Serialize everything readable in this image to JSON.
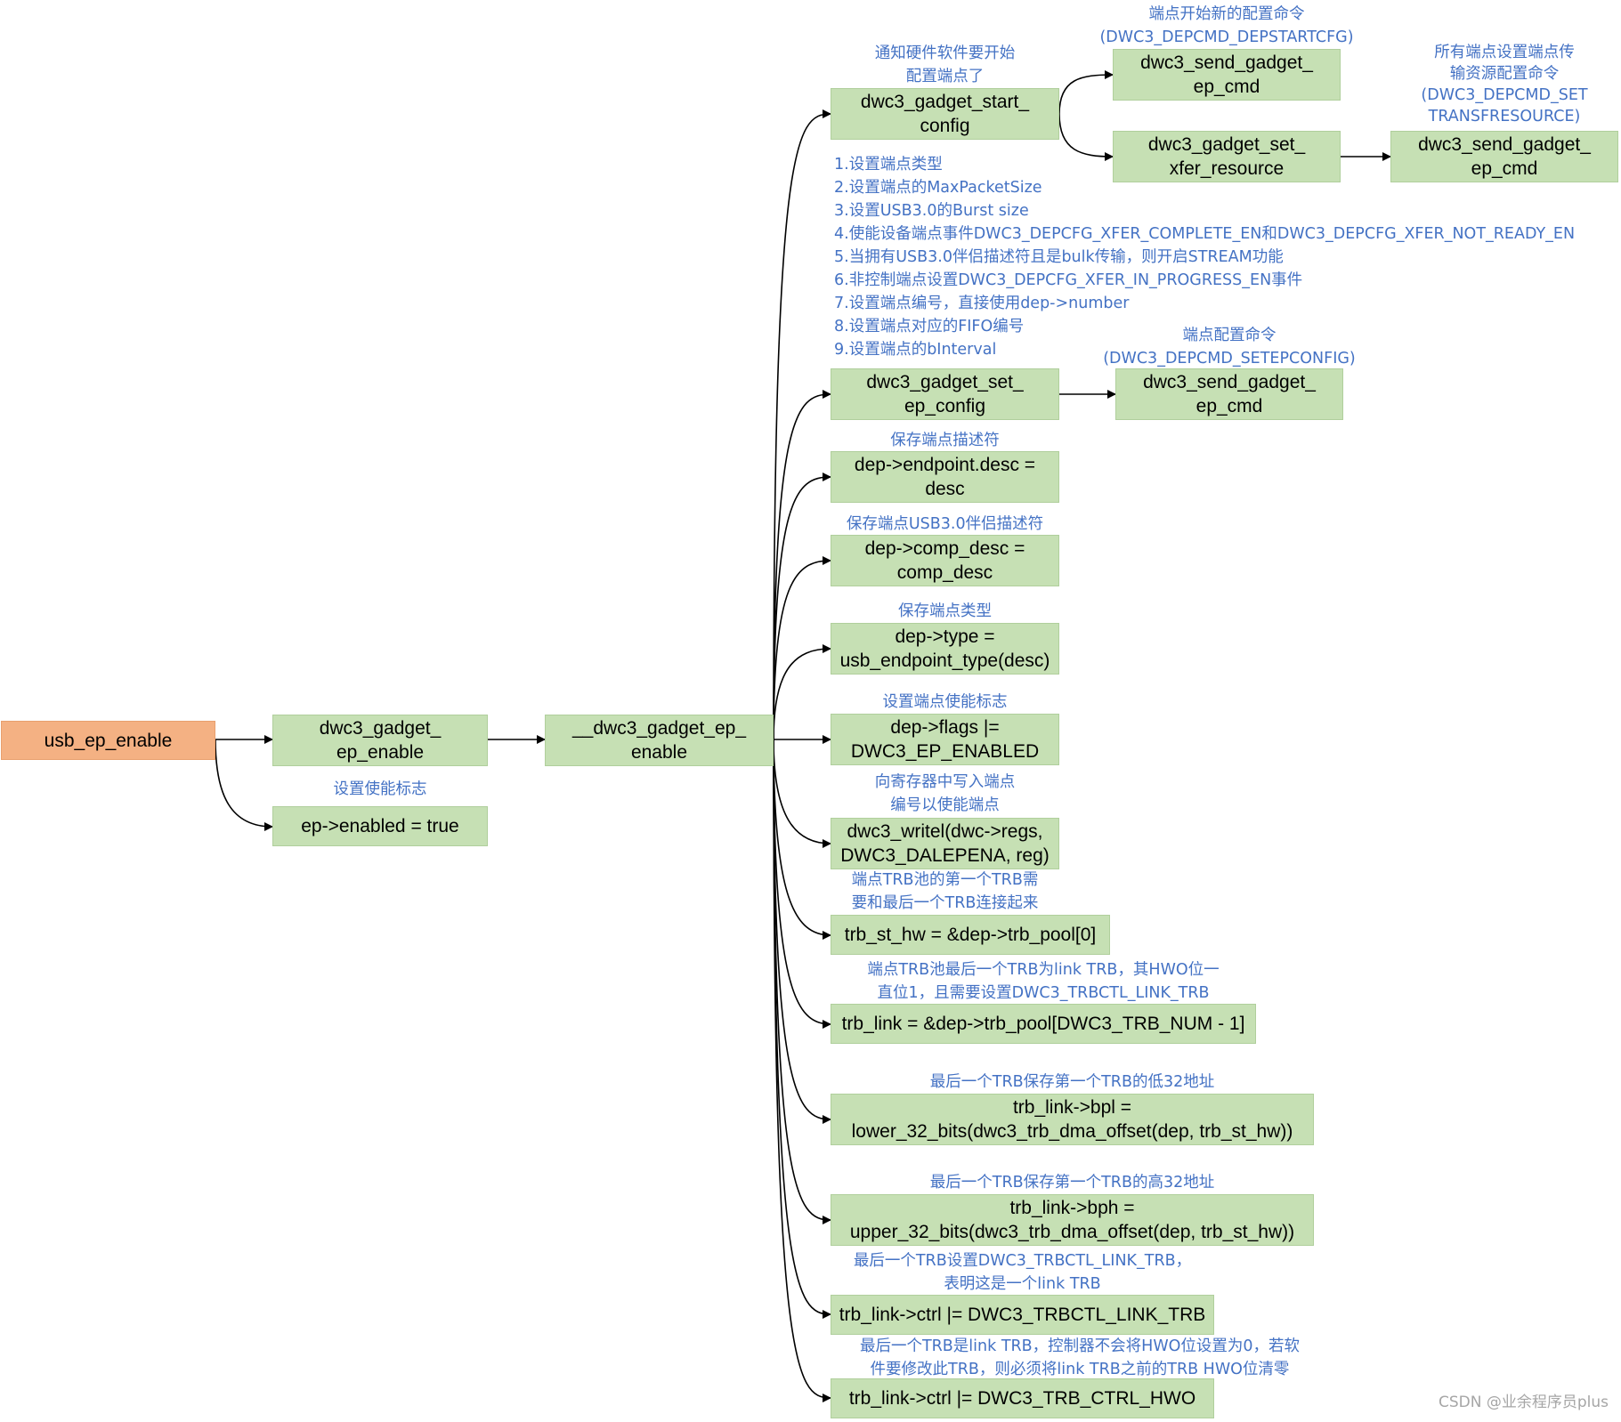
{
  "diagram": {
    "nodes": {
      "usb_ep_enable": "usb_ep_enable",
      "dwc3_gadget_ep_enable": "dwc3_gadget_\nep_enable",
      "ep_enabled_true": "ep->enabled = true",
      "__dwc3_gadget_ep_enable": "__dwc3_gadget_ep_\nenable",
      "dwc3_gadget_start_config": "dwc3_gadget_start_\nconfig",
      "send_cmd_start": "dwc3_send_gadget_\nep_cmd",
      "dwc3_gadget_set_xfer_resource": "dwc3_gadget_set_\nxfer_resource",
      "send_cmd_xfer": "dwc3_send_gadget_\nep_cmd",
      "dwc3_gadget_set_ep_config": "dwc3_gadget_set_\nep_config",
      "send_cmd_config": "dwc3_send_gadget_\nep_cmd",
      "endpoint_desc": "dep->endpoint.desc =\ndesc",
      "comp_desc": "dep->comp_desc =\ncomp_desc",
      "dep_type": "dep->type =\nusb_endpoint_type(desc)",
      "dep_flags": "dep->flags |=\nDWC3_EP_ENABLED",
      "dwc3_writel": "dwc3_writel(dwc->regs,\nDWC3_DALEPENA, reg)",
      "trb_st_hw": "trb_st_hw = &dep->trb_pool[0]",
      "trb_link": "trb_link = &dep->trb_pool[DWC3_TRB_NUM - 1]",
      "trb_link_bpl": "trb_link->bpl =\nlower_32_bits(dwc3_trb_dma_offset(dep, trb_st_hw))",
      "trb_link_bph": "trb_link->bph =\nupper_32_bits(dwc3_trb_dma_offset(dep, trb_st_hw))",
      "trb_link_ctrl_link": "trb_link->ctrl |= DWC3_TRBCTL_LINK_TRB",
      "trb_link_ctrl_hwo": "trb_link->ctrl |= DWC3_TRB_CTRL_HWO"
    },
    "notes": {
      "set_enable_flag": "设置使能标志",
      "notify_hw": "通知硬件软件要开始\n配置端点了",
      "start_cfg_cmd": "端点开始新的配置命令\n(DWC3_DEPCMD_DEPSTARTCFG)",
      "xfer_resource_cmd": "所有端点设置端点传\n输资源配置命令\n(DWC3_DEPCMD_SET\nTRANSFRESOURCE)",
      "ep_config_steps": "1.设置端点类型\n2.设置端点的MaxPacketSize\n3.设置USB3.0的Burst size\n4.使能设备端点事件DWC3_DEPCFG_XFER_COMPLETE_EN和DWC3_DEPCFG_XFER_NOT_READY_EN\n5.当拥有USB3.0伴侣描述符且是bulk传输，则开启STREAM功能\n6.非控制端点设置DWC3_DEPCFG_XFER_IN_PROGRESS_EN事件\n7.设置端点编号，直接使用dep->number\n8.设置端点对应的FIFO编号\n9.设置端点的bInterval",
      "setepconfig_cmd": "端点配置命令\n(DWC3_DEPCMD_SETEPCONFIG)",
      "save_desc": "保存端点描述符",
      "save_comp_desc": "保存端点USB3.0伴侣描述符",
      "save_type": "保存端点类型",
      "set_enable_flag2": "设置端点使能标志",
      "write_reg": "向寄存器中写入端点\n编号以使能端点",
      "trb_first": "端点TRB池的第一个TRB需\n要和最后一个TRB连接起来",
      "trb_last": "端点TRB池最后一个TRB为link TRB，其HWO位一\n直位1，且需要设置DWC3_TRBCTL_LINK_TRB",
      "low32": "最后一个TRB保存第一个TRB的低32地址",
      "high32": "最后一个TRB保存第一个TRB的高32地址",
      "link_trb": "最后一个TRB设置DWC3_TRBCTL_LINK_TRB，\n表明这是一个link TRB",
      "hwo_note": "最后一个TRB是link TRB，控制器不会将HWO位设置为0，若软\n件要修改此TRB，则必须将link TRB之前的TRB HWO位清零"
    },
    "watermark": "CSDN @业余程序员plus"
  }
}
